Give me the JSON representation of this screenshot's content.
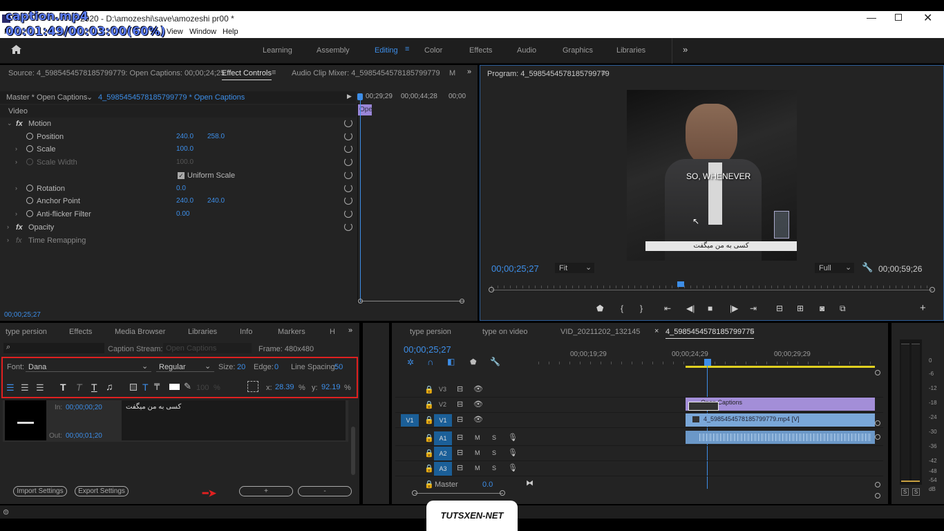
{
  "overlay": {
    "filename": "caption.mp4",
    "time": "00:01:49/00:03:00(60%)"
  },
  "titlebar": {
    "app_tail": "2020 - D:\\amozeshi\\save\\amozeshi pr00 *"
  },
  "menu": {
    "view": "View",
    "window": "Window",
    "help": "Help"
  },
  "workspaces": [
    "Learning",
    "Assembly",
    "Editing",
    "Color",
    "Effects",
    "Audio",
    "Graphics",
    "Libraries"
  ],
  "source_panel": {
    "tab_source": "Source: 4_5985454578185799779: Open Captions: 00;00;24;25",
    "tab_effect": "Effect Controls",
    "tab_audio": "Audio Clip Mixer: 4_5985454578185799779",
    "tab_more": "M",
    "master": "Master * Open Captions",
    "clip": "4_5985454578185799779 * Open Captions",
    "ruler": [
      "00;29;29",
      "00;00;44;28",
      "00;00"
    ],
    "clip_label": "Ope",
    "video": "Video",
    "motion": "Motion",
    "position": {
      "label": "Position",
      "x": "240.0",
      "y": "258.0"
    },
    "scale": {
      "label": "Scale",
      "v": "100.0"
    },
    "scale_width": {
      "label": "Scale Width",
      "v": "100.0"
    },
    "uniform": "Uniform Scale",
    "rotation": {
      "label": "Rotation",
      "v": "0.0"
    },
    "anchor": {
      "label": "Anchor Point",
      "x": "240.0",
      "y": "240.0"
    },
    "antiflicker": {
      "label": "Anti-flicker Filter",
      "v": "0.00"
    },
    "opacity": "Opacity",
    "remap": "Time Remapping",
    "timecode": "00;00;25;27"
  },
  "program": {
    "title": "Program: 4_5985454578185799779",
    "subtitle": "SO, WHENEVER",
    "caption": "کسی به من میگفت",
    "timecode": "00;00;25;27",
    "fit": "Fit",
    "quality": "Full",
    "duration": "00;00;59;26",
    "playhead": 0.43
  },
  "captions_panel": {
    "tabs": [
      "type persion",
      "Effects",
      "Media Browser",
      "Libraries",
      "Info",
      "Markers",
      "H"
    ],
    "stream_label": "Caption Stream:",
    "stream_value": "Open Captions",
    "frame": "Frame:  480x480",
    "font_label": "Font:",
    "font": "Dana",
    "style": "Regular",
    "size_label": "Size:",
    "size": "20",
    "edge_label": "Edge:",
    "edge": "0",
    "spacing_label": "Line Spacing:",
    "spacing": "50",
    "opacity": "100",
    "pct": "%",
    "x_label": "x:",
    "x": "28.39",
    "y_label": "y:",
    "y": "92.19",
    "in_label": "In:",
    "in": "00;00;00;20",
    "out_label": "Out:",
    "out": "00;00;01;20",
    "text": "کسی به من میگفت",
    "import": "Import Settings",
    "export": "Export Settings",
    "add": "+",
    "remove": "-"
  },
  "timeline": {
    "tabs": [
      "type persion",
      "type on video",
      "VID_20211202_132145",
      "4_5985454578185799775"
    ],
    "close": "×",
    "timecode": "00;00;25;27",
    "ruler": [
      "00;00;19;29",
      "00;00;24;29",
      "00;00;29;29"
    ],
    "tracks_v": [
      "V3",
      "V2",
      "V1"
    ],
    "source_v": "V1",
    "tracks_a": [
      "A1",
      "A2",
      "A3"
    ],
    "m": "M",
    "s": "S",
    "master": "Master",
    "master_val": "0.0",
    "caption_clip": "Open Captions",
    "video_clip": "4_5985454578185799779.mp4 [V]"
  },
  "meter": {
    "ticks": [
      "0",
      "-6",
      "-12",
      "-18",
      "-24",
      "-30",
      "-36",
      "-42",
      "-48",
      "-54",
      "dB"
    ],
    "solo": [
      "S",
      "S"
    ]
  },
  "watermark": "TUTSXEN-NET"
}
